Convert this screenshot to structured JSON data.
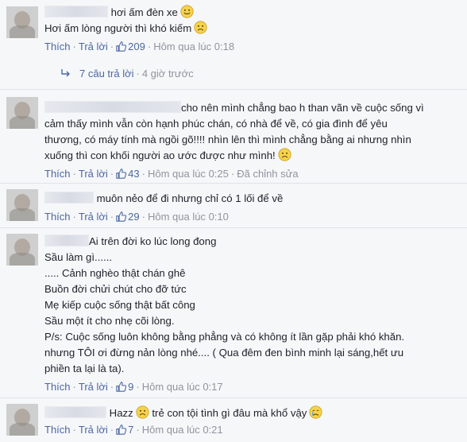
{
  "actions": {
    "like": "Thích",
    "reply": "Trả lời",
    "dot": "·",
    "yesterday_prefix": "Hôm qua lúc"
  },
  "comments": [
    {
      "lines": [
        "hơi ấm đèn xe",
        "Hơi ấm lòng người thì khó kiếm"
      ],
      "likes": "209",
      "time": "0:18",
      "edited": ""
    },
    {
      "lines": [
        "cho nên mình chẳng bao h than vãn về cuộc sống vì",
        "cảm thấy mình vẫn còn hạnh phúc chán, có nhà để về, có gia đình để yêu",
        "thương, có máy tính mà ngồi gõ!!!! nhìn lên thì mình chẳng bằng ai nhưng nhìn",
        "xuống thì con khối người ao ước được như mình!"
      ],
      "likes": "43",
      "time": "0:25",
      "edited": "Đã chỉnh sửa"
    },
    {
      "lines": [
        "muôn nẻo để đi nhưng chỉ có 1 lối để về"
      ],
      "likes": "29",
      "time": "0:10",
      "edited": ""
    },
    {
      "lines": [
        "Ai trên đời ko lúc long đong",
        "Sầu làm gì......",
        "..... Cảnh nghèo thật chán ghê",
        "Buồn đời chửi chút cho đỡ tức",
        "Mẹ kiếp cuộc sống thật bất công",
        "Sầu một ít cho nhẹ cõi lòng.",
        "P/s: Cuộc sống luôn không bằng phẳng và có không ít lần gặp phải khó khăn.",
        "nhưng TÔI ơi đừng nản lòng nhé.... ( Qua đêm đen bình minh lại sáng,hết ưu",
        "phiền ta lại là ta)."
      ],
      "likes": "9",
      "time": "0:17",
      "edited": ""
    },
    {
      "lines": [
        "Hazz",
        "trẻ con tội tình gì đâu mà khổ vậy"
      ],
      "likes": "7",
      "time": "0:21",
      "edited": ""
    }
  ],
  "replies": {
    "label": "7 câu trả lời",
    "time": "4 giờ trước"
  },
  "colors": {
    "link": "#4b67a1",
    "meta": "#90949c",
    "text": "#1d2129",
    "background": "#f6f7f9"
  }
}
